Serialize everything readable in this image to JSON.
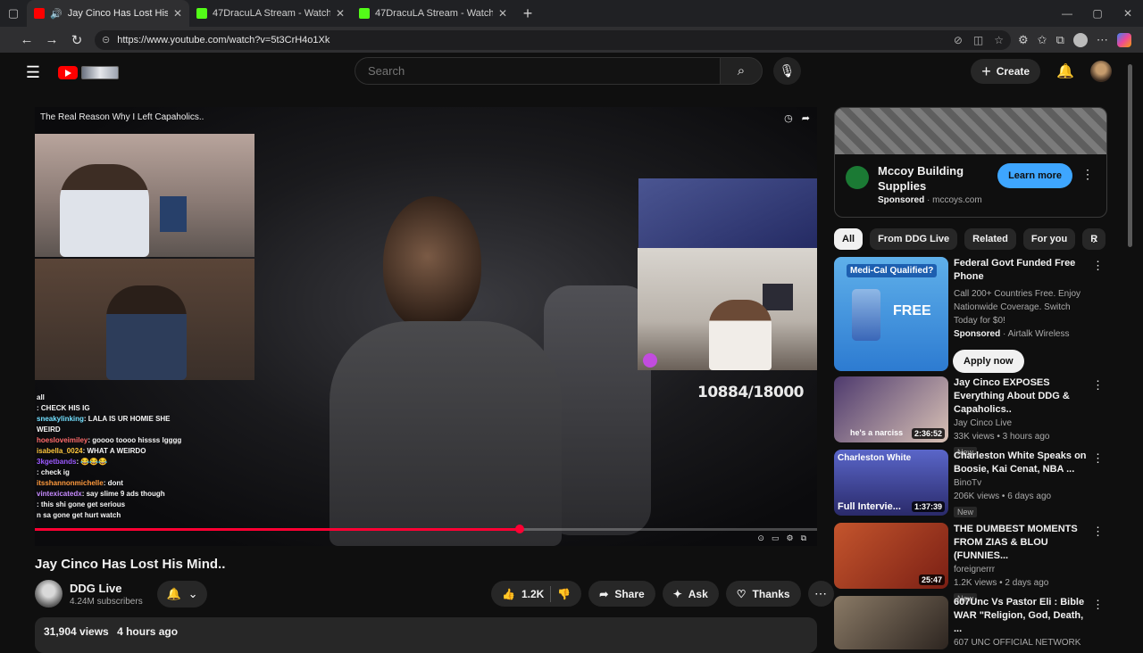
{
  "browser": {
    "tabs": [
      {
        "title": "Jay Cinco Has Lost His Mind..",
        "favicon": "youtube",
        "active": true
      },
      {
        "title": "47DracuLA Stream - Watch Live o",
        "favicon": "kick",
        "active": false
      },
      {
        "title": "47DracuLA Stream - Watch Live o",
        "favicon": "kick",
        "active": false
      }
    ],
    "url": "https://www.youtube.com/watch?v=5t3CrH4o1Xk"
  },
  "masthead": {
    "search_placeholder": "Search",
    "create_label": "Create"
  },
  "player": {
    "overlay_title": "The Real Reason Why I Left Capaholics..",
    "counter": "10884/18000",
    "progress_fraction": 0.62,
    "chat": [
      {
        "user": "",
        "msg": "all"
      },
      {
        "user": "",
        "msg": ": CHECK HIS IG"
      },
      {
        "user": "sneakylinking",
        "msg": ": LALA IS UR HOMIE SHE WEIRD"
      },
      {
        "user": "hoesloveimiley",
        "msg": ": goooo toooo hissss lgggg"
      },
      {
        "user": "isabella_0024",
        "msg": ": WHAT A WEIRDO"
      },
      {
        "user": "3kgetbands",
        "msg": ": 😂😂😂"
      },
      {
        "user": "",
        "msg": ": check ig"
      },
      {
        "user": "itsshannonmichelle",
        "msg": ": dont"
      },
      {
        "user": "vintexicatedx",
        "msg": ": say slime 9 ads though"
      },
      {
        "user": "",
        "msg": ": this shi gone get serious"
      },
      {
        "user": "",
        "msg": "n sa gone get hurt watch"
      }
    ]
  },
  "video": {
    "title": "Jay Cinco Has Lost His Mind..",
    "channel": "DDG Live",
    "subscribers": "4.24M subscribers",
    "likes": "1.2K",
    "share_label": "Share",
    "ask_label": "Ask",
    "thanks_label": "Thanks",
    "views": "31,904 views",
    "posted": "4 hours ago"
  },
  "ad": {
    "name": "Mccoy Building Supplies",
    "sponsored": "Sponsored",
    "domain": "mccoys.com",
    "cta": "Learn more"
  },
  "chips": [
    "All",
    "From DDG Live",
    "Related",
    "For you",
    "R"
  ],
  "recommendations": [
    {
      "title": "Federal Govt Funded Free Phone",
      "desc": "Call 200+ Countries Free. Enjoy Nationwide Coverage. Switch Today for $0!",
      "sponsor_label": "Sponsored",
      "advertiser": "Airtalk Wireless",
      "cta": "Apply now",
      "thumb_badge": "Medi-Cal Qualified?",
      "thumb_text": "FREE"
    },
    {
      "title": "Jay Cinco EXPOSES Everything About DDG & Capaholics..",
      "channel": "Jay Cinco Live",
      "meta": "33K views • 3 hours ago",
      "badge": "New",
      "duration": "2:36:52",
      "thumb_text": "he's a narciss"
    },
    {
      "title": "Charleston White Speaks on Boosie, Kai Cenat, NBA ...",
      "channel": "BinoTv",
      "meta": "206K views • 6 days ago",
      "badge": "New",
      "duration": "1:37:39",
      "thumb_text": "Charleston White",
      "thumb_text2": "Full Intervie..."
    },
    {
      "title": "THE DUMBEST MOMENTS FROM ZIAS & BLOU (FUNNIES...",
      "channel": "foreignerrr",
      "meta": "1.2K views • 2 days ago",
      "badge": "New",
      "duration": "25:47"
    },
    {
      "title": "607Unc Vs Pastor Eli : Bible WAR \"Religion, God, Death, ...",
      "channel": "607 UNC OFFICIAL NETWORK",
      "meta": "",
      "badge": "",
      "duration": ""
    }
  ],
  "colors": {
    "background": "#0f0f0f",
    "accent_red": "#ff0033",
    "learn_more_blue": "#3ea6ff",
    "chip_bg": "#272727"
  }
}
